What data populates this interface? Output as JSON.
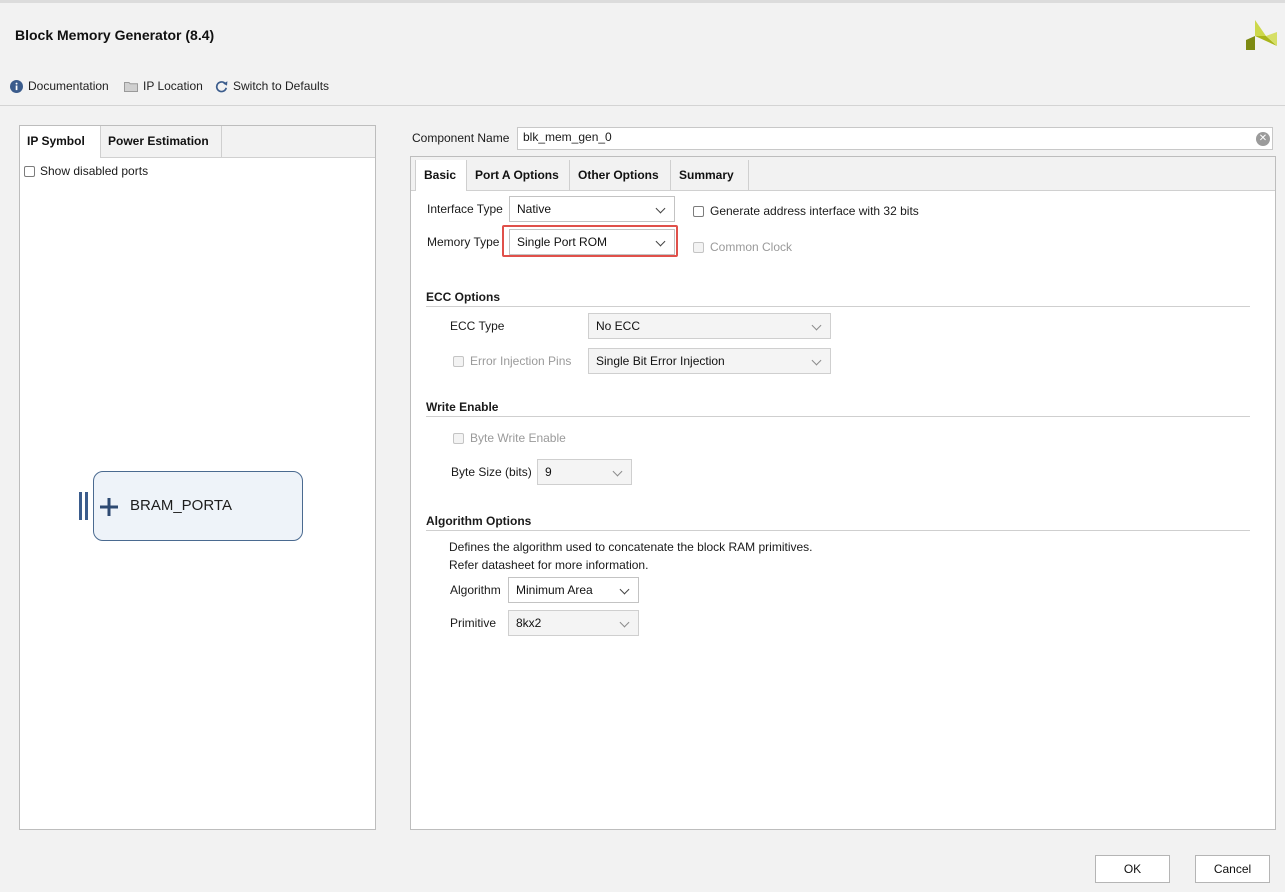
{
  "window": {
    "title": "Block Memory Generator (8.4)"
  },
  "toolbar": {
    "documentation": "Documentation",
    "ip_location": "IP Location",
    "switch_to_defaults": "Switch to Defaults"
  },
  "left_panel": {
    "tabs": [
      {
        "label": "IP Symbol"
      },
      {
        "label": "Power Estimation"
      }
    ],
    "show_disabled_ports": "Show disabled ports",
    "symbol_label": "BRAM_PORTA"
  },
  "component": {
    "label": "Component Name",
    "value": "blk_mem_gen_0"
  },
  "right_panel": {
    "tabs": [
      {
        "label": "Basic"
      },
      {
        "label": "Port A Options"
      },
      {
        "label": "Other Options"
      },
      {
        "label": "Summary"
      }
    ],
    "interface_type": {
      "label": "Interface Type",
      "value": "Native"
    },
    "memory_type": {
      "label": "Memory Type",
      "value": "Single Port ROM"
    },
    "generate_address": "Generate address interface with 32 bits",
    "common_clock": "Common Clock",
    "ecc": {
      "title": "ECC Options",
      "type_label": "ECC Type",
      "type_value": "No ECC",
      "error_injection_label": "Error Injection Pins",
      "error_injection_value": "Single Bit Error Injection"
    },
    "write_enable": {
      "title": "Write Enable",
      "byte_write_enable": "Byte Write Enable",
      "byte_size_label": "Byte Size (bits)",
      "byte_size_value": "9"
    },
    "algorithm": {
      "title": "Algorithm Options",
      "desc1": "Defines the algorithm used to concatenate the block RAM primitives.",
      "desc2": "Refer datasheet for more information.",
      "algorithm_label": "Algorithm",
      "algorithm_value": "Minimum Area",
      "primitive_label": "Primitive",
      "primitive_value": "8kx2"
    }
  },
  "buttons": {
    "ok": "OK",
    "cancel": "Cancel"
  },
  "colors": {
    "highlight": "#e0504a",
    "logo": "#b5c21e",
    "symbol_border": "#4a6a90"
  }
}
